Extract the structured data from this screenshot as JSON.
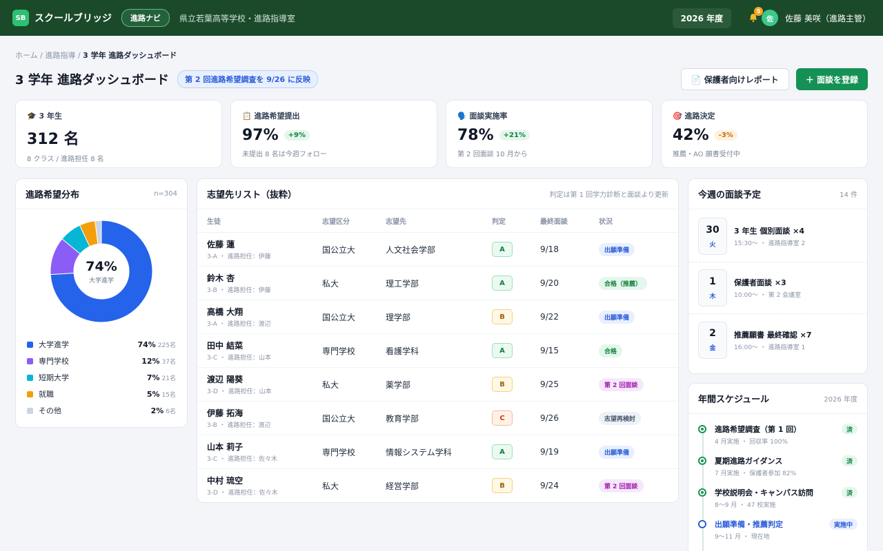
{
  "header": {
    "logo": "SB",
    "app_name": "スクールブリッジ",
    "nav_pill": "進路ナビ",
    "school": "県立若葉高等学校・進路指導室",
    "year": "2026 年度",
    "notif_count": "5",
    "avatar": "佐",
    "user": "佐藤 美咲（進路主管）"
  },
  "breadcrumb": {
    "home": "ホーム",
    "section": "進路指導",
    "current": "3 学年 進路ダッシュボード",
    "sep": "/"
  },
  "page": {
    "title": "3 学年 進路ダッシュボード",
    "badge": "第 2 回進路希望調査を 9/26 に反映",
    "report_button": "📄 保護者向けレポート",
    "register_button": "＋ 面談を登録"
  },
  "kpis": [
    {
      "icon": "🎓",
      "label": "3 年生",
      "value": "312 名",
      "delta": "",
      "sub": "8 クラス / 進路担任 8 名"
    },
    {
      "icon": "📋",
      "label": "進路希望提出",
      "value": "97%",
      "delta": "+9%",
      "sub": "未提出 8 名は今週フォロー"
    },
    {
      "icon": "🗣️",
      "label": "面談実施率",
      "value": "78%",
      "delta": "+21%",
      "sub": "第 2 回面談 10 月から"
    },
    {
      "icon": "🎯",
      "label": "進路決定",
      "value": "42%",
      "delta": "-3%",
      "sub": "推薦・AO 願書受付中"
    }
  ],
  "distribution": {
    "title": "進路希望分布",
    "n": "n=304",
    "center_pct": "74%",
    "center_label": "大学進学",
    "colors": [
      "#2563eb",
      "#8b5cf6",
      "#06b6d4",
      "#f59e0b",
      "#cbd5e1"
    ],
    "items": [
      {
        "name": "大学進学",
        "pct": "74%",
        "count": "225名",
        "value": 74
      },
      {
        "name": "専門学校",
        "pct": "12%",
        "count": "37名",
        "value": 12
      },
      {
        "name": "短期大学",
        "pct": "7%",
        "count": "21名",
        "value": 7
      },
      {
        "name": "就職",
        "pct": "5%",
        "count": "15名",
        "value": 5
      },
      {
        "name": "その他",
        "pct": "2%",
        "count": "6名",
        "value": 2
      }
    ]
  },
  "targets": {
    "title": "志望先リスト（抜粋）",
    "note": "判定は第 1 回学力診断と面談より更新",
    "columns": [
      "生徒",
      "志望区分",
      "志望先",
      "判定",
      "最終面談",
      "状況"
    ],
    "rows": [
      {
        "name": "佐藤 蓮",
        "sub": "3-A ・ 進路担任：伊藤",
        "type": "国公立大",
        "target": "人文社会学部",
        "grade": "A",
        "date": "9/18",
        "status": "出願準備",
        "status_color": "blue"
      },
      {
        "name": "鈴木 杏",
        "sub": "3-B ・ 進路担任：伊藤",
        "type": "私大",
        "target": "理工学部",
        "grade": "A",
        "date": "9/20",
        "status": "合格（推薦）",
        "status_color": "green"
      },
      {
        "name": "高橋 大翔",
        "sub": "3-A ・ 進路担任：渡辺",
        "type": "国公立大",
        "target": "理学部",
        "grade": "B",
        "date": "9/22",
        "status": "出願準備",
        "status_color": "blue"
      },
      {
        "name": "田中 結菜",
        "sub": "3-C ・ 進路担任：山本",
        "type": "専門学校",
        "target": "看護学科",
        "grade": "A",
        "date": "9/15",
        "status": "合格",
        "status_color": "green"
      },
      {
        "name": "渡辺 陽葵",
        "sub": "3-D ・ 進路担任：山本",
        "type": "私大",
        "target": "薬学部",
        "grade": "B",
        "date": "9/25",
        "status": "第 2 回面談",
        "status_color": "purple"
      },
      {
        "name": "伊藤 拓海",
        "sub": "3-B ・ 進路担任：渡辺",
        "type": "国公立大",
        "target": "教育学部",
        "grade": "C",
        "date": "9/26",
        "status": "志望再検討",
        "status_color": "gray"
      },
      {
        "name": "山本 莉子",
        "sub": "3-C ・ 進路担任：佐々木",
        "type": "専門学校",
        "target": "情報システム学科",
        "grade": "A",
        "date": "9/19",
        "status": "出願準備",
        "status_color": "blue"
      },
      {
        "name": "中村 琉空",
        "sub": "3-D ・ 進路担任：佐々木",
        "type": "私大",
        "target": "経営学部",
        "grade": "B",
        "date": "9/24",
        "status": "第 2 回面談",
        "status_color": "purple"
      }
    ]
  },
  "weekly": {
    "title": "今週の面談予定",
    "count": "14 件",
    "items": [
      {
        "day": "30",
        "weekday": "火",
        "title": "3 年生 個別面談 ×4",
        "sub": "15:30〜 ・ 進路指導室 2"
      },
      {
        "day": "1",
        "weekday": "木",
        "title": "保護者面談 ×3",
        "sub": "10:00〜 ・ 第 2 会議室"
      },
      {
        "day": "2",
        "weekday": "金",
        "title": "推薦願書 最終確認 ×7",
        "sub": "16:00〜 ・ 進路指導室 1"
      }
    ]
  },
  "annual": {
    "title": "年間スケジュール",
    "year": "2026 年度",
    "items": [
      {
        "title": "進路希望調査（第 1 回）",
        "sub": "4 月実施 ・ 回収率 100%",
        "badge": "済",
        "state": "done"
      },
      {
        "title": "夏期進路ガイダンス",
        "sub": "7 月実施 ・ 保護者参加 82%",
        "badge": "済",
        "state": "done"
      },
      {
        "title": "学校説明会・キャンパス訪問",
        "sub": "8〜9 月 ・ 47 校実施",
        "badge": "済",
        "state": "done"
      },
      {
        "title": "出願準備・推薦判定",
        "sub": "9〜11 月 ・ 現在地",
        "badge": "実施中",
        "state": "active"
      }
    ]
  }
}
